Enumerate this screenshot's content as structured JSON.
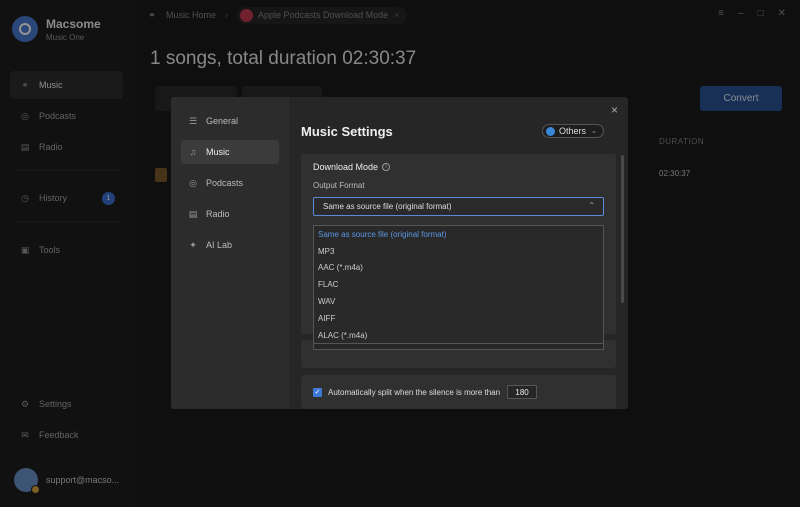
{
  "app": {
    "name": "Macsome",
    "subtitle": "Music One"
  },
  "sidebar": {
    "items": [
      {
        "label": "Music",
        "icon": "headphones-icon"
      },
      {
        "label": "Podcasts",
        "icon": "podcast-icon"
      },
      {
        "label": "Radio",
        "icon": "radio-icon"
      },
      {
        "label": "History",
        "icon": "clock-icon",
        "badge": "1"
      },
      {
        "label": "Tools",
        "icon": "toolbox-icon"
      },
      {
        "label": "Settings",
        "icon": "gear-icon"
      },
      {
        "label": "Feedback",
        "icon": "mail-icon"
      }
    ],
    "user_email": "support@macso..."
  },
  "topbar": {
    "home_label": "Music Home",
    "mode_label": "Apple Podcasts Download Mode",
    "close_symbol": "×"
  },
  "main": {
    "title": "1 songs, total duration 02:30:37",
    "convert_label": "Convert",
    "duration_header": "DURATION",
    "duration_value": "02:30:37"
  },
  "dialog": {
    "title": "Music Settings",
    "others_label": "Others",
    "close_symbol": "×",
    "nav": [
      {
        "label": "General",
        "icon": "sliders-icon"
      },
      {
        "label": "Music",
        "icon": "music-note-icon"
      },
      {
        "label": "Podcasts",
        "icon": "podcast-icon"
      },
      {
        "label": "Radio",
        "icon": "radio-icon"
      },
      {
        "label": "AI Lab",
        "icon": "ai-icon"
      }
    ],
    "download_mode_label": "Download Mode",
    "output_format_label": "Output Format",
    "output_format_value": "Same as source file (original format)",
    "format_options": [
      "Same as source file (original format)",
      "MP3",
      "AAC (*.m4a)",
      "FLAC",
      "WAV",
      "AIFF",
      "ALAC (*.m4a)"
    ],
    "split_label": "Automatically split when the silence is more than",
    "split_value": "180"
  },
  "colors": {
    "accent": "#3c7ad6",
    "convert": "#2c5494",
    "podcast_red": "#c23a4e"
  }
}
